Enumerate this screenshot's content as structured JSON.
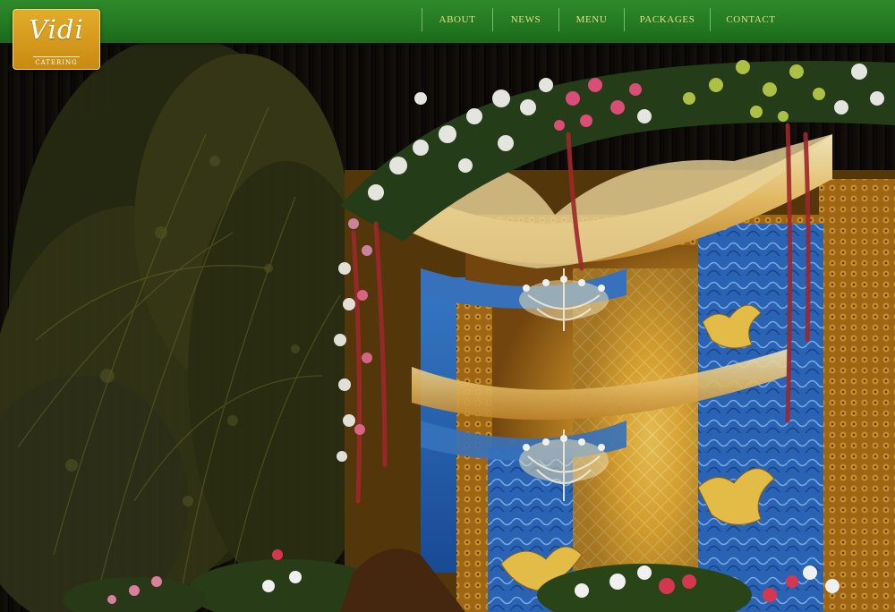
{
  "brand": {
    "logo_text": "Vidi",
    "logo_subtitle": "CATERING"
  },
  "nav": {
    "items": [
      {
        "label": "ABOUT"
      },
      {
        "label": "NEWS"
      },
      {
        "label": "MENU"
      },
      {
        "label": "PACKAGES"
      },
      {
        "label": "CONTACT"
      }
    ]
  },
  "colors": {
    "header_green": "#247a22",
    "nav_text_gold": "#eed98a",
    "logo_gold": "#d89a1c"
  },
  "hero": {
    "image": "wedding-stage-decoration"
  }
}
